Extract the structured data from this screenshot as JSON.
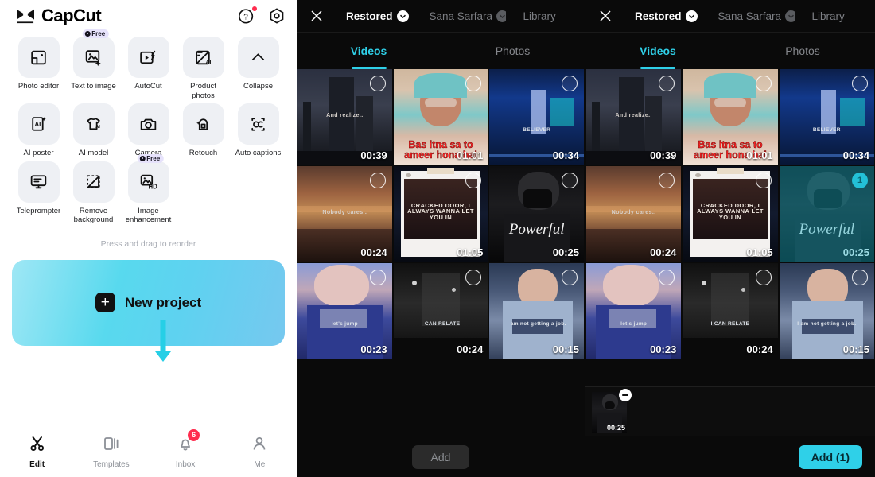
{
  "left": {
    "brand": "CapCut",
    "top_icons": [
      {
        "name": "help-icon",
        "has_dot": true
      },
      {
        "name": "settings-icon",
        "has_dot": false
      }
    ],
    "tools": [
      {
        "label": "Photo editor",
        "icon": "photo-editor-icon",
        "badge": ""
      },
      {
        "label": "Text to image",
        "icon": "text-to-image-icon",
        "badge": "Free"
      },
      {
        "label": "AutoCut",
        "icon": "autocut-icon",
        "badge": ""
      },
      {
        "label": "Product photos",
        "icon": "product-photos-icon",
        "badge": ""
      },
      {
        "label": "Collapse",
        "icon": "chevron-up-icon",
        "badge": ""
      },
      {
        "label": "AI poster",
        "icon": "ai-poster-icon",
        "badge": ""
      },
      {
        "label": "AI model",
        "icon": "ai-model-icon",
        "badge": ""
      },
      {
        "label": "Camera",
        "icon": "camera-icon",
        "badge": ""
      },
      {
        "label": "Retouch",
        "icon": "retouch-icon",
        "badge": ""
      },
      {
        "label": "Auto captions",
        "icon": "auto-captions-icon",
        "badge": ""
      },
      {
        "label": "Teleprompter",
        "icon": "teleprompter-icon",
        "badge": ""
      },
      {
        "label": "Remove background",
        "icon": "remove-background-icon",
        "badge": ""
      },
      {
        "label": "Image enhancement",
        "icon": "image-enhancement-icon",
        "badge": "Free"
      }
    ],
    "reorder_hint": "Press and drag to reorder",
    "new_project_label": "New project",
    "nav": [
      {
        "label": "Edit",
        "icon": "scissors-icon",
        "badge": "",
        "active": true
      },
      {
        "label": "Templates",
        "icon": "templates-icon",
        "badge": "",
        "active": false
      },
      {
        "label": "Inbox",
        "icon": "bell-icon",
        "badge": "6",
        "active": false
      },
      {
        "label": "Me",
        "icon": "person-icon",
        "badge": "",
        "active": false
      }
    ]
  },
  "middle": {
    "close_label": "close-icon",
    "sources": [
      {
        "label": "Restored",
        "active": true,
        "chevron": true
      },
      {
        "label": "Sana Sarfara",
        "active": false,
        "chevron": true
      },
      {
        "label": "Library",
        "active": false,
        "chevron": false
      }
    ],
    "tabs": [
      {
        "label": "Videos",
        "active": true
      },
      {
        "label": "Photos",
        "active": false
      }
    ],
    "add_label": "Add",
    "add_enabled": false
  },
  "right": {
    "close_label": "close-icon",
    "sources": [
      {
        "label": "Restored",
        "active": true,
        "chevron": true
      },
      {
        "label": "Sana Sarfara",
        "active": false,
        "chevron": true
      },
      {
        "label": "Library",
        "active": false,
        "chevron": false
      }
    ],
    "tabs": [
      {
        "label": "Videos",
        "active": true
      },
      {
        "label": "Photos",
        "active": false
      }
    ],
    "tray": [
      {
        "duration": "00:25",
        "art": "powerful",
        "remove_label": "remove-icon"
      }
    ],
    "add_label": "Add (1)",
    "add_enabled": true
  },
  "clips": [
    {
      "duration": "00:39",
      "art": "city-night",
      "caption": "And realize..",
      "caption_style": "thin",
      "selected": false,
      "badge": ""
    },
    {
      "duration": "01:01",
      "art": "person-scarf",
      "caption": "Bas itna sa to ameer hona hai",
      "caption_style": "red",
      "selected": false,
      "badge": ""
    },
    {
      "duration": "00:34",
      "art": "concert-stage",
      "caption": "BELIEVER",
      "caption_style": "small-white",
      "selected": false,
      "badge": ""
    },
    {
      "duration": "00:24",
      "art": "sunset-sea",
      "caption": "Nobody cares..",
      "caption_style": "thin",
      "selected": false,
      "badge": ""
    },
    {
      "duration": "01:05",
      "art": "insta-post",
      "caption": "CRACKED DOOR, I ALWAYS WANNA LET YOU IN",
      "caption_style": "post",
      "selected": false,
      "badge": ""
    },
    {
      "duration": "00:25",
      "art": "powerful",
      "caption": "Powerful",
      "caption_style": "script",
      "selected": false,
      "badge": ""
    },
    {
      "duration": "00:23",
      "art": "singer-blue",
      "caption": "let's jump",
      "caption_style": "small-white",
      "selected": false,
      "badge": ""
    },
    {
      "duration": "00:24",
      "art": "bw-street",
      "caption": "I CAN RELATE",
      "caption_style": "small-white",
      "selected": false,
      "badge": ""
    },
    {
      "duration": "00:15",
      "art": "girl-sweater",
      "caption": "I am not getting a job.",
      "caption_style": "small-white",
      "selected": false,
      "badge": ""
    }
  ],
  "right_selected_index": 5,
  "right_selected_badge": "1",
  "colors": {
    "accent_cyan": "#2fd0e8",
    "annotation_cyan": "#26cfe6",
    "badge_red": "#ff2d4f",
    "panel_dark": "#0a0a0a",
    "tile_gray": "#eef0f4",
    "caption_red": "#ff2525"
  }
}
